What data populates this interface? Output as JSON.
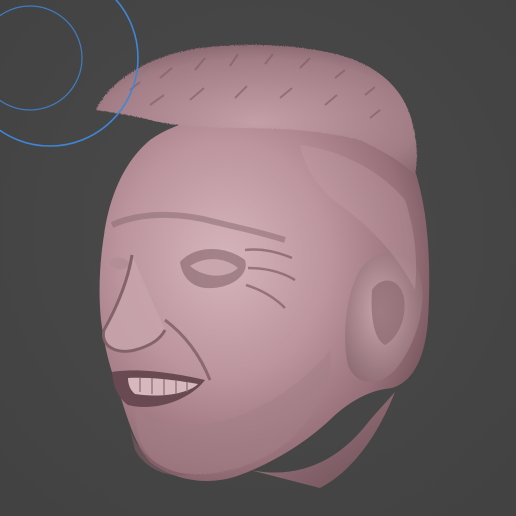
{
  "viewport": {
    "background_color": "#474747",
    "mesh_color": "#b48d95",
    "mesh_shadow_color": "#6d4d55",
    "mesh_highlight_color": "#d8b8bf",
    "brush_cursor_color": "#3f86d6"
  },
  "model": {
    "subject": "sculpted-male-head",
    "material": "clay-matcap-pink"
  },
  "brush_cursor": {
    "shape": "double-ring"
  }
}
